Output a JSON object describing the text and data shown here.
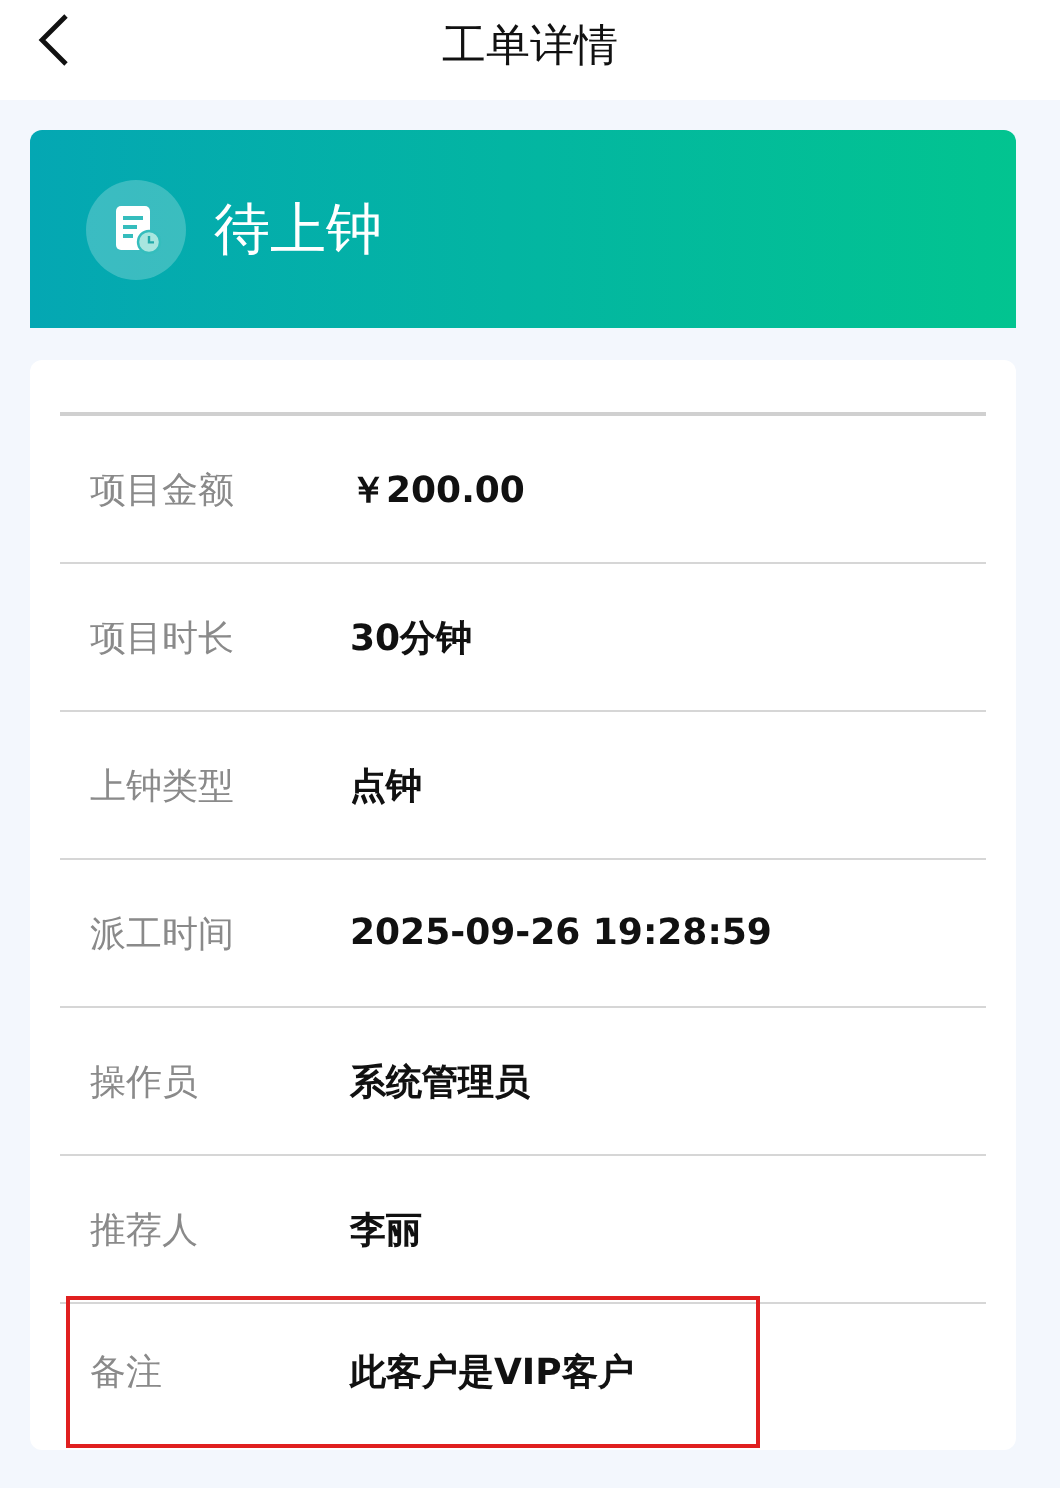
{
  "header": {
    "title": "工单详情"
  },
  "status": {
    "label": "待上钟"
  },
  "details": [
    {
      "label": "项目金额",
      "value": "￥200.00",
      "highlighted": false
    },
    {
      "label": "项目时长",
      "value": "30分钟",
      "highlighted": false
    },
    {
      "label": "上钟类型",
      "value": "点钟",
      "highlighted": false
    },
    {
      "label": "派工时间",
      "value": "2025-09-26 19:28:59",
      "highlighted": false
    },
    {
      "label": "操作员",
      "value": "系统管理员",
      "highlighted": false
    },
    {
      "label": "推荐人",
      "value": "李丽",
      "highlighted": false
    },
    {
      "label": "备注",
      "value": "此客户是VIP客户",
      "highlighted": true
    }
  ]
}
